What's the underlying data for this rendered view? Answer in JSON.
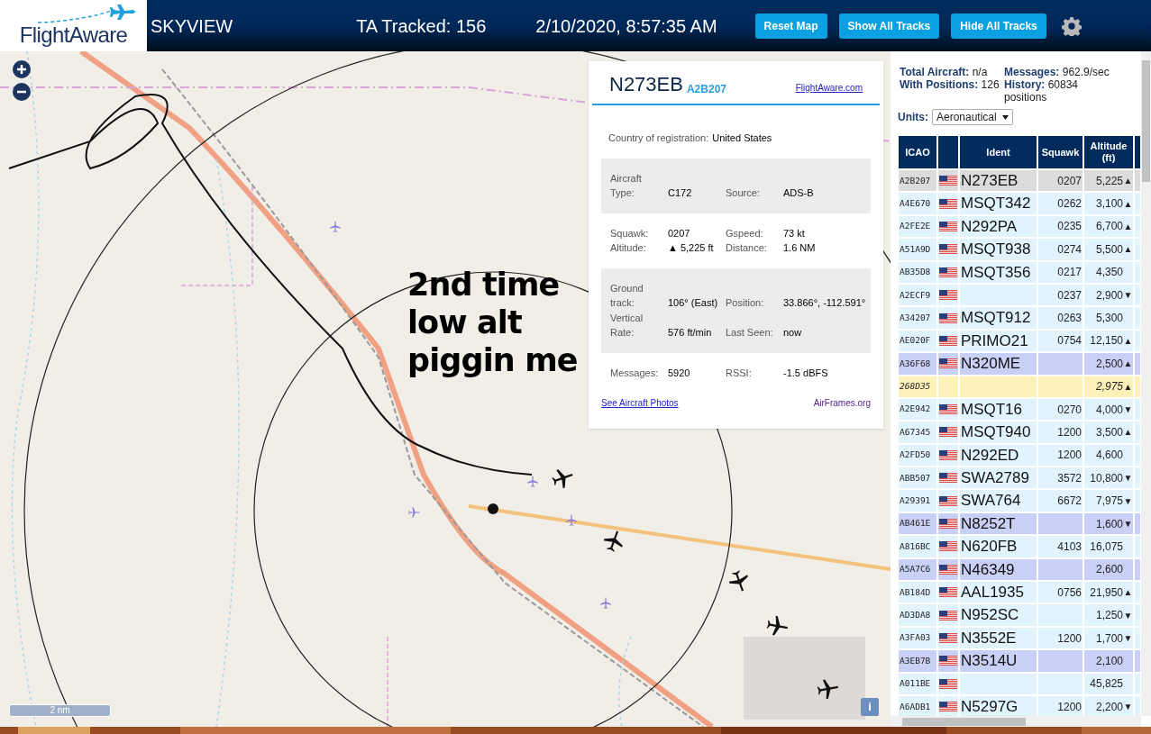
{
  "header": {
    "logo": "FlightAware",
    "title": "SKYVIEW",
    "tracked": "TA Tracked: 156",
    "datetime": "2/10/2020, 8:57:35 AM",
    "buttons": [
      "Reset Map",
      "Show All Tracks",
      "Hide All Tracks"
    ]
  },
  "map": {
    "annotation": "2nd time\nlow alt\npiggin me",
    "scale": "2 nm",
    "info": "i"
  },
  "popup": {
    "ident": "N273EB",
    "icao": "A2B207",
    "link": "FlightAware.com",
    "country_label": "Country of registration:",
    "country": "United States",
    "sections": [
      {
        "shaded": true,
        "rows": [
          [
            "Aircraft Type:",
            "C172",
            "Source:",
            "ADS-B"
          ]
        ]
      },
      {
        "shaded": false,
        "rows": [
          [
            "Squawk:",
            "0207",
            "Gspeed:",
            "73 kt"
          ],
          [
            "Altitude:",
            "▲ 5,225 ft",
            "Distance:",
            "1.6 NM"
          ]
        ]
      },
      {
        "shaded": true,
        "rows": [
          [
            "Ground track:",
            "106° (East)",
            "Position:",
            "33.866°, -112.591°"
          ],
          [
            "Vertical Rate:",
            "576 ft/min",
            "Last Seen:",
            "now"
          ]
        ]
      },
      {
        "shaded": false,
        "rows": [
          [
            "Messages:",
            "5920",
            "RSSI:",
            "-1.5 dBFS"
          ]
        ]
      }
    ],
    "photos_link": "See Aircraft Photos",
    "airframes_link": "AirFrames.org"
  },
  "stats": [
    "**Total Aircraft:** n/a",
    "**Messages:** 962.9/sec",
    "**With Positions:** 126",
    "**History:** 60834 positions"
  ],
  "units": {
    "label": "Units:",
    "value": "Aeronautical"
  },
  "table": {
    "columns": [
      "ICAO",
      "Ident",
      "Squawk",
      "Altitude (ft)"
    ],
    "rows": [
      {
        "icao": "A2B207",
        "flag": true,
        "ident": "N273EB",
        "squawk": "0207",
        "altitude": "5,225",
        "trend": "▲",
        "kind": "adsb",
        "selected": true
      },
      {
        "icao": "A4E670",
        "flag": true,
        "ident": "MSQT342",
        "squawk": "0262",
        "altitude": "3,100",
        "trend": "▲",
        "kind": "adsb",
        "selected": false
      },
      {
        "icao": "A2FE2E",
        "flag": true,
        "ident": "N292PA",
        "squawk": "0235",
        "altitude": "6,700",
        "trend": "▲",
        "kind": "adsb",
        "selected": false
      },
      {
        "icao": "A51A9D",
        "flag": true,
        "ident": "MSQT938",
        "squawk": "0274",
        "altitude": "5,500",
        "trend": "▲",
        "kind": "adsb",
        "selected": false
      },
      {
        "icao": "AB35D8",
        "flag": true,
        "ident": "MSQT356",
        "squawk": "0217",
        "altitude": "4,350",
        "kind": "adsb",
        "selected": false
      },
      {
        "icao": "A2ECF9",
        "flag": true,
        "squawk": "0237",
        "altitude": "2,900",
        "trend": "▼",
        "kind": "adsb",
        "selected": false
      },
      {
        "icao": "A34207",
        "flag": true,
        "ident": "MSQT912",
        "squawk": "0263",
        "altitude": "5,300",
        "kind": "adsb",
        "selected": false
      },
      {
        "icao": "AE020F",
        "flag": true,
        "ident": "PRIMO21",
        "squawk": "0754",
        "altitude": "12,150",
        "trend": "▲",
        "kind": "adsb",
        "selected": false
      },
      {
        "icao": "A36F68",
        "flag": true,
        "ident": "N320ME",
        "altitude": "2,500",
        "trend": "▲",
        "kind": "mlat",
        "selected": false
      },
      {
        "icao": "268D35",
        "flag": false,
        "altitude": "2,975",
        "trend": "▲",
        "kind": "tisb",
        "selected": false
      },
      {
        "icao": "A2E942",
        "flag": true,
        "ident": "MSQT16",
        "squawk": "0270",
        "altitude": "4,000",
        "trend": "▼",
        "kind": "adsb",
        "selected": false
      },
      {
        "icao": "A67345",
        "flag": true,
        "ident": "MSQT940",
        "squawk": "1200",
        "altitude": "3,500",
        "trend": "▲",
        "kind": "adsb",
        "selected": false
      },
      {
        "icao": "A2FD50",
        "flag": true,
        "ident": "N292ED",
        "squawk": "1200",
        "altitude": "4,600",
        "kind": "adsb",
        "selected": false
      },
      {
        "icao": "ABB507",
        "flag": true,
        "ident": "SWA2789",
        "squawk": "3572",
        "altitude": "10,800",
        "trend": "▼",
        "kind": "adsb",
        "selected": false
      },
      {
        "icao": "A29391",
        "flag": true,
        "ident": "SWA764",
        "squawk": "6672",
        "altitude": "7,975",
        "trend": "▼",
        "kind": "adsb",
        "selected": false
      },
      {
        "icao": "AB461E",
        "flag": true,
        "ident": "N8252T",
        "altitude": "1,600",
        "trend": "▼",
        "kind": "mlat",
        "selected": false
      },
      {
        "icao": "A816BC",
        "flag": true,
        "ident": "N620FB",
        "squawk": "4103",
        "altitude": "16,075",
        "kind": "adsb",
        "selected": false
      },
      {
        "icao": "A5A7C6",
        "flag": true,
        "ident": "N46349",
        "altitude": "2,600",
        "kind": "mlat",
        "selected": false
      },
      {
        "icao": "AB184D",
        "flag": true,
        "ident": "AAL1935",
        "squawk": "0756",
        "altitude": "21,950",
        "trend": "▲",
        "kind": "adsb",
        "selected": false
      },
      {
        "icao": "AD3DA8",
        "flag": true,
        "ident": "N952SC",
        "altitude": "1,250",
        "trend": "▼",
        "kind": "adsb",
        "selected": false
      },
      {
        "icao": "A3FA03",
        "flag": true,
        "ident": "N3552E",
        "squawk": "1200",
        "altitude": "1,700",
        "trend": "▼",
        "kind": "adsb",
        "selected": false
      },
      {
        "icao": "A3EB7B",
        "flag": true,
        "ident": "N3514U",
        "altitude": "2,100",
        "kind": "mlat",
        "selected": false
      },
      {
        "icao": "A011BE",
        "flag": true,
        "altitude": "45,825",
        "kind": "adsb",
        "selected": false
      },
      {
        "icao": "A6ADB1",
        "flag": true,
        "ident": "N5297G",
        "squawk": "1200",
        "altitude": "2,200",
        "trend": "▼",
        "kind": "adsb",
        "selected": false
      }
    ]
  }
}
